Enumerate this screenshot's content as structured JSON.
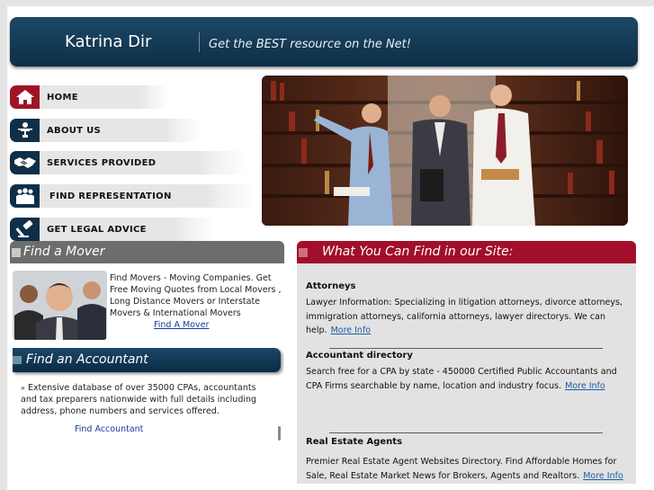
{
  "header": {
    "brand": "Katrina Dir",
    "tagline": "Get the BEST resource on the Net!"
  },
  "nav": {
    "items": [
      {
        "label": "HOME",
        "icon": "house-icon"
      },
      {
        "label": "ABOUT US",
        "icon": "person-at-desk-icon"
      },
      {
        "label": "SERVICES PROVIDED",
        "icon": "handshake-icon"
      },
      {
        "label": "FIND REPRESENTATION",
        "icon": "group-icon"
      },
      {
        "label": "GET LEGAL ADVICE",
        "icon": "gavel-icon"
      }
    ]
  },
  "mover": {
    "title": "Find a Mover",
    "text": "Find Movers - Moving Companies. Get Free Moving Quotes from Local Movers , Long Distance Movers or Interstate Movers & International Movers",
    "link": "Find A Mover"
  },
  "accountant": {
    "title": "Find an Accountant",
    "bullet": "»",
    "text": "Extensive database of over 35000 CPAs, accountants and tax preparers nationwide with full details including address, phone numbers and services offered.",
    "link": "Find Accountant"
  },
  "site": {
    "title": "What You Can Find in our Site:",
    "sections": [
      {
        "title": "Attorneys",
        "body": "Lawyer Information: Specializing in litigation attorneys, divorce attorneys, immigration attorneys, california attorneys, lawyer directorys. We can help.",
        "more": "More Info"
      },
      {
        "title": "Accountant directory",
        "body": "Search free for a CPA by state - 450000 Certified Public Accountants and CPA Firms searchable by name, location and industry focus.",
        "more": "More Info"
      },
      {
        "title": "Real Estate Agents",
        "body": "Premier Real Estate Agent Websites Directory. Find Affordable Homes for Sale, Real Estate Market News for Brokers, Agents and Realtors.",
        "more": "More Info"
      }
    ]
  },
  "colors": {
    "navy": "#0e2f47",
    "crimson": "#a20f2a",
    "panel_gray": "#e2e2e2"
  }
}
